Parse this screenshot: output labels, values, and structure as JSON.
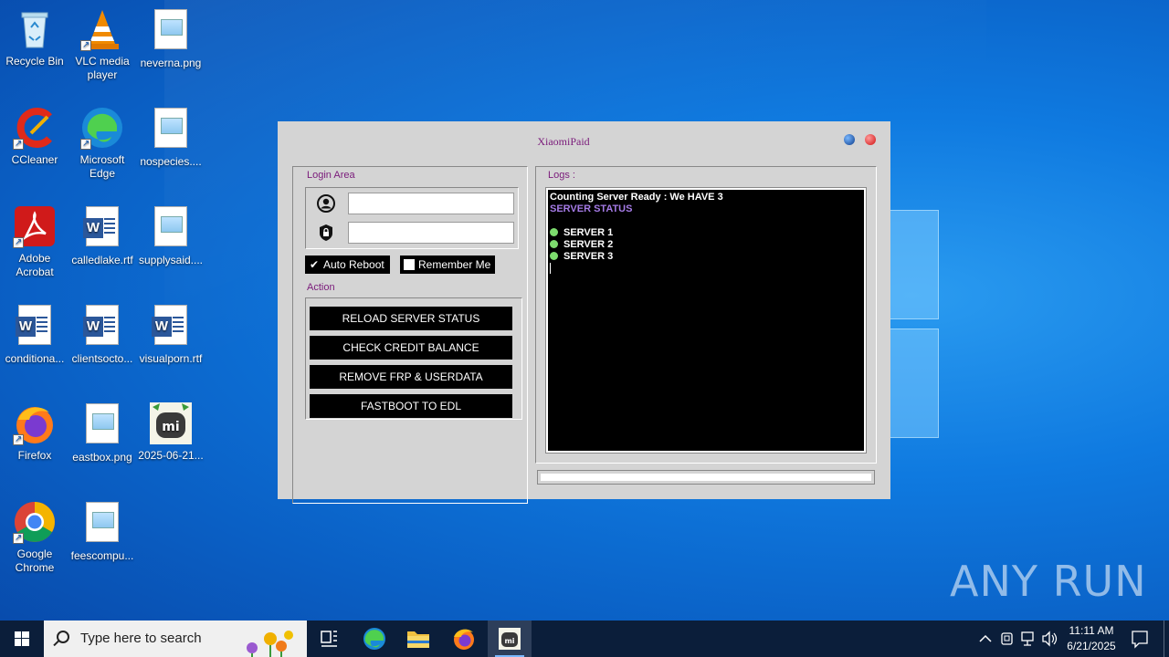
{
  "desktop": {
    "icons": [
      {
        "label": "Recycle Bin"
      },
      {
        "label": "VLC media player"
      },
      {
        "label": "neverna.png"
      },
      {
        "label": "CCleaner"
      },
      {
        "label": "Microsoft Edge"
      },
      {
        "label": "nospecies...."
      },
      {
        "label": "Adobe Acrobat"
      },
      {
        "label": "calledlake.rtf"
      },
      {
        "label": "supplysaid...."
      },
      {
        "label": "conditiona..."
      },
      {
        "label": "clientsocto..."
      },
      {
        "label": "visualporn.rtf"
      },
      {
        "label": "Firefox"
      },
      {
        "label": "eastbox.png"
      },
      {
        "label": "2025-06-21..."
      },
      {
        "label": "Google Chrome"
      },
      {
        "label": "feescompu..."
      }
    ]
  },
  "app": {
    "title": "XiaomiPaid",
    "login_area_label": "Login Area",
    "username_value": "",
    "password_value": "",
    "auto_reboot_label": "Auto Reboot",
    "auto_reboot_checked": true,
    "remember_me_label": "Remember Me",
    "remember_me_checked": false,
    "action_label": "Action",
    "buttons": {
      "reload": "RELOAD SERVER STATUS",
      "credit": "CHECK CREDIT BALANCE",
      "frp": "REMOVE FRP & USERDATA",
      "edl": "FASTBOOT TO EDL"
    },
    "logs_label": "Logs :",
    "logs": {
      "line1": "Counting Server Ready : We HAVE 3",
      "line2": "SERVER STATUS",
      "server1": "SERVER 1",
      "server2": "SERVER 2",
      "server3": "SERVER 3"
    },
    "colors": {
      "status_green": "#7ddc6e",
      "title_purple": "#7a1a7a"
    }
  },
  "taskbar": {
    "search_placeholder": "Type here to search",
    "time": "11:11 AM",
    "date": "6/21/2025"
  },
  "watermark": "ANY RUN"
}
